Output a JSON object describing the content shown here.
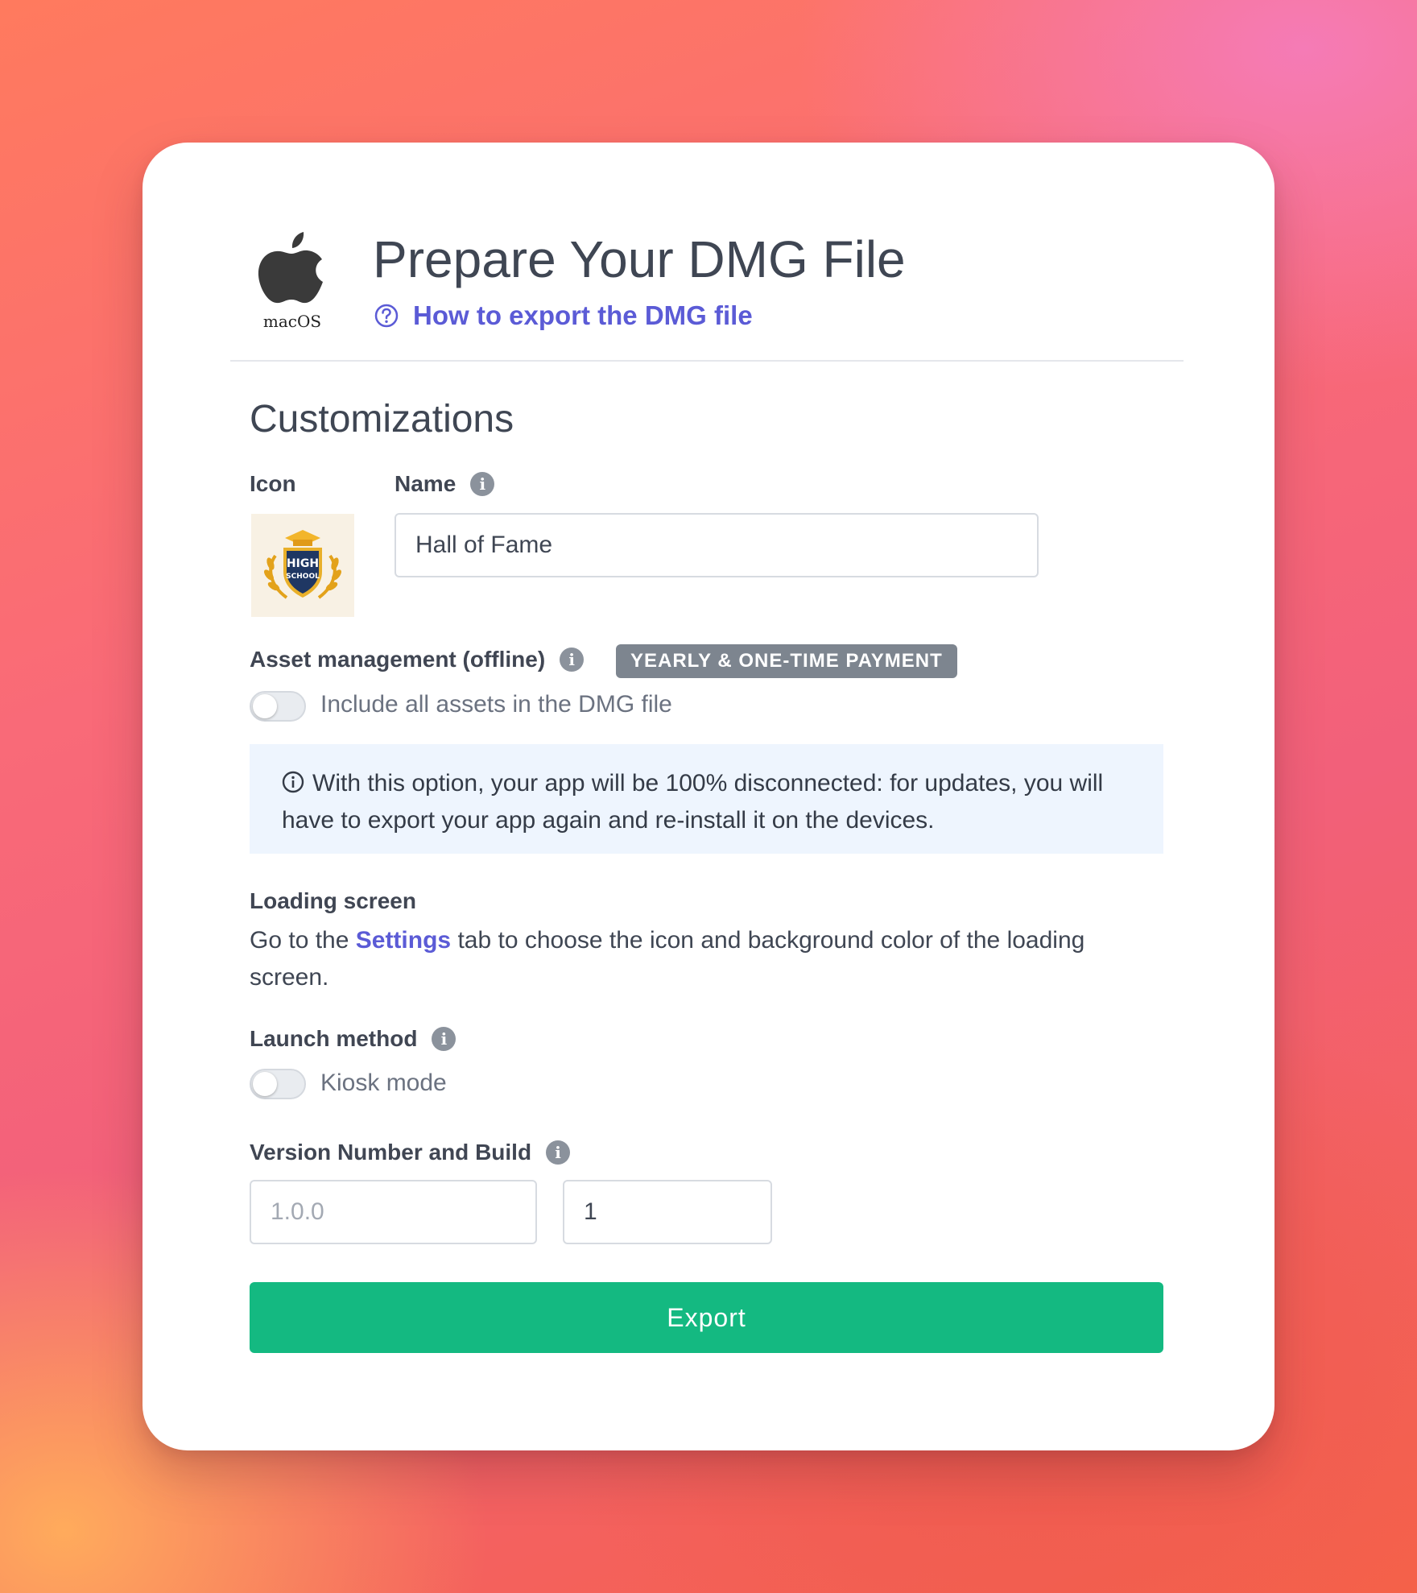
{
  "header": {
    "platform_label": "macOS",
    "title": "Prepare Your DMG File",
    "help_link": "How to export the DMG file"
  },
  "customizations": {
    "section_title": "Customizations",
    "icon_label": "Icon",
    "icon_image": {
      "line1": "HIGH",
      "line2": "SCHOOL"
    },
    "name_label": "Name",
    "name_value": "Hall of Fame"
  },
  "asset_management": {
    "label": "Asset management (offline)",
    "badge": "YEARLY & ONE-TIME PAYMENT",
    "toggle_label": "Include all assets in the DMG file",
    "toggle_on": false,
    "notice": "With this option, your app will be 100% disconnected: for updates, you will have to export your app again and re-install it on the devices."
  },
  "loading_screen": {
    "label": "Loading screen",
    "text_before": "Go to the ",
    "settings_link": "Settings",
    "text_after": " tab to choose the icon and background color of the loading screen."
  },
  "launch_method": {
    "label": "Launch method",
    "toggle_label": "Kiosk mode",
    "toggle_on": false
  },
  "version": {
    "label": "Version Number and Build",
    "version_placeholder": "1.0.0",
    "version_value": "",
    "build_value": "1"
  },
  "export_button": "Export",
  "colors": {
    "accent": "#5b5bd6",
    "export_green": "#14b981",
    "badge_gray": "#7d858f",
    "notice_bg": "#eef5fe",
    "title_text": "#3f4653"
  }
}
